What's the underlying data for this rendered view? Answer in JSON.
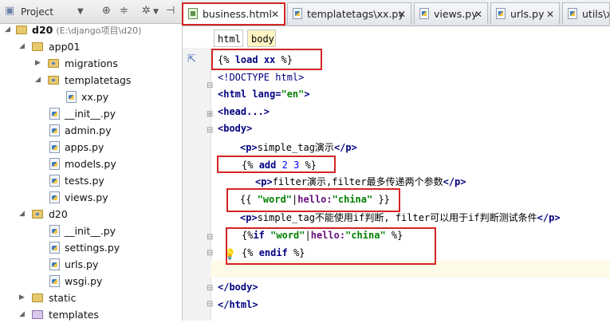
{
  "project_pane": {
    "title": "Project",
    "tree": [
      {
        "label": "d20",
        "sublabel": "(E:\\django项目\\d20)",
        "kind": "root"
      },
      {
        "label": "app01",
        "kind": "folder"
      },
      {
        "label": "migrations",
        "kind": "folder"
      },
      {
        "label": "templatetags",
        "kind": "folder"
      },
      {
        "label": "xx.py",
        "kind": "py"
      },
      {
        "label": "__init__.py",
        "kind": "py"
      },
      {
        "label": "admin.py",
        "kind": "py"
      },
      {
        "label": "apps.py",
        "kind": "py"
      },
      {
        "label": "models.py",
        "kind": "py"
      },
      {
        "label": "tests.py",
        "kind": "py"
      },
      {
        "label": "views.py",
        "kind": "py"
      },
      {
        "label": "d20",
        "kind": "folder"
      },
      {
        "label": "__init__.py",
        "kind": "py"
      },
      {
        "label": "settings.py",
        "kind": "py"
      },
      {
        "label": "urls.py",
        "kind": "py"
      },
      {
        "label": "wsgi.py",
        "kind": "py"
      },
      {
        "label": "static",
        "kind": "folder"
      },
      {
        "label": "templates",
        "kind": "folder"
      }
    ]
  },
  "tabs": [
    {
      "label": "business.html",
      "active": true
    },
    {
      "label": "templatetags\\xx.py",
      "active": false
    },
    {
      "label": "views.py",
      "active": false
    },
    {
      "label": "urls.py",
      "active": false
    },
    {
      "label": "utils\\x",
      "active": false
    }
  ],
  "breadcrumb": [
    "html",
    "body"
  ],
  "code": {
    "l1_open": "{%",
    "l1_kw": "load",
    "l1_name": "xx",
    "l1_close": "%}",
    "l2": "<!DOCTYPE html>",
    "l3_a": "<html",
    "l3_b": "lang=",
    "l3_c": "\"en\"",
    "l3_d": ">",
    "l4": "<head...>",
    "l5": "<body>",
    "l6_a": "<p>",
    "l6_b": "simple_tag演示",
    "l6_c": "</p>",
    "l7_open": "{%",
    "l7_kw": "add",
    "l7_n1": "2",
    "l7_n2": "3",
    "l7_close": "%}",
    "l8_a": "<p>",
    "l8_b": "filter演示,filter最多传递两个参数",
    "l8_c": "</p>",
    "l9_open": "{{",
    "l9_s1": "\"word\"",
    "l9_pipe": "|",
    "l9_fn": "hello:",
    "l9_s2": "\"china\"",
    "l9_close": "}}",
    "l10_a": "<p>",
    "l10_b": "simple_tag不能使用if判断, filter可以用于if判断测试条件",
    "l10_c": "</p>",
    "l11_open": "{%",
    "l11_kw": "if",
    "l11_s1": "\"word\"",
    "l11_pipe": "|",
    "l11_fn": "hello:",
    "l11_s2": "\"china\"",
    "l11_close": "%}",
    "l12_open": "{%",
    "l12_kw": "endif",
    "l12_close": "%}",
    "l14": "</body>",
    "l15": "</html>"
  }
}
